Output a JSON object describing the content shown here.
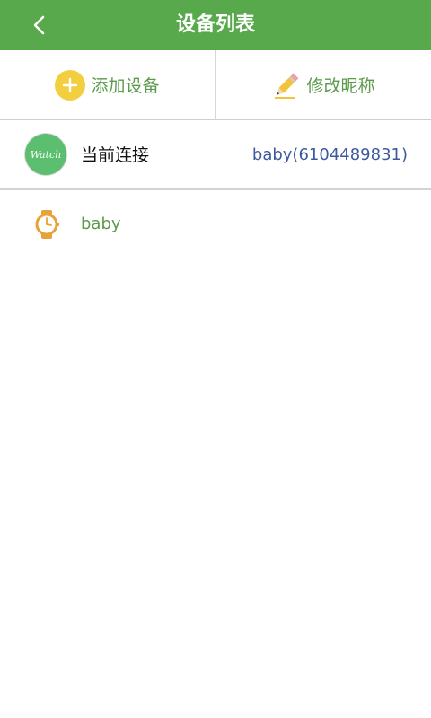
{
  "header": {
    "title": "设备列表",
    "back_icon": "chevron-left-icon",
    "background_color": "#58a84c"
  },
  "actions": {
    "add_device": {
      "label": "添加设备",
      "icon": "plus-circle-icon",
      "icon_color": "#f3cf3f"
    },
    "edit_nickname": {
      "label": "修改昵称",
      "icon": "pencil-icon"
    }
  },
  "current_connection": {
    "label": "当前连接",
    "value": "baby(6104489831)",
    "badge_text": "Watch",
    "badge_color": "#5cbf70"
  },
  "devices": [
    {
      "name": "baby",
      "icon": "watch-icon",
      "icon_color": "#e8a23a"
    }
  ]
}
